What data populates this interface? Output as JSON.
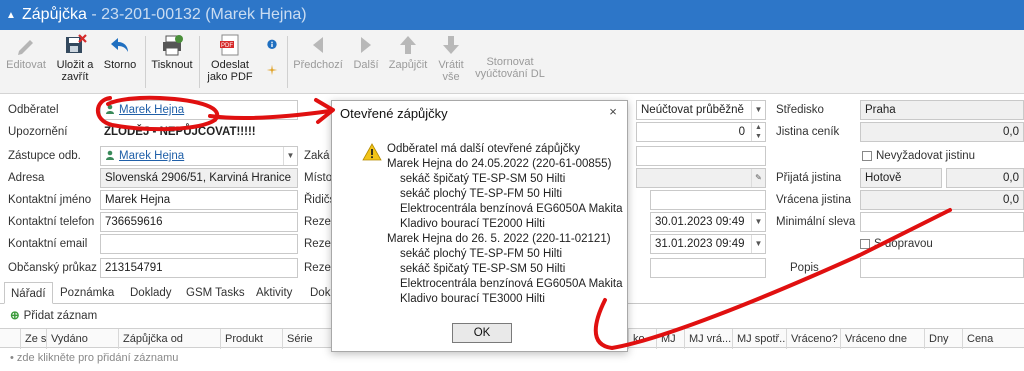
{
  "window": {
    "title": "Zápůjčka",
    "title_sep": " - ",
    "doc_ref": "23-201-00132 (Marek Hejna)"
  },
  "toolbar": {
    "edit": "Editovat",
    "save_close_1": "Uložit a",
    "save_close_2": "zavřít",
    "cancel": "Storno",
    "print": "Tisknout",
    "pdf_1": "Odeslat",
    "pdf_2": "jako PDF",
    "prev": "Předchozí",
    "next": "Další",
    "post": "Zapůjčit",
    "return_1": "Vrátit",
    "return_2": "vše",
    "cancel_bill_1": "Stornovat",
    "cancel_bill_2": "vyúčtování DL"
  },
  "form": {
    "customer_label": "Odběratel",
    "customer_value": "Marek Hejna",
    "warning_label": "Upozornění",
    "warning_value": "ZLODĚJ - NEPŮJČOVAT!!!!!",
    "rep_label": "Zástupce odb.",
    "rep_value": "Marek Hejna",
    "order_label": "Zaká",
    "address_label": "Adresa",
    "address_value": "Slovenská 2906/51, Karviná Hranice",
    "place_label": "Místo",
    "contact_name_label": "Kontaktní jméno",
    "contact_name_value": "Marek Hejna",
    "driver_label": "Řidičs",
    "contact_phone_label": "Kontaktní telefon",
    "contact_phone_value": "736659616",
    "reserv1_label": "Rezer",
    "contact_email_label": "Kontaktní email",
    "reserv2_label": "Rezer",
    "id_card_label": "Občanský průkaz",
    "id_card_value": "213154791",
    "reserv3_label": "Rezer",
    "billing_value": "Neúčtovat průběžně",
    "qty_value": "0",
    "date1_value": "30.01.2023 09:49",
    "date2_value": "31.01.2023 09:49",
    "center_label": "Středisko",
    "center_value": "Praha",
    "deposit_price_label": "Jistina ceník",
    "deposit_price_value": "0,0",
    "no_deposit_label": "Nevyžadovat jistinu",
    "accepted_deposit_label": "Přijatá jistina",
    "accepted_deposit_value": "Hotově",
    "accepted_deposit_amount": "0,0",
    "returned_deposit_label": "Vrácena jistina",
    "returned_deposit_value": "0,0",
    "min_discount_label": "Minimální sleva",
    "transport_label": "S dopravou",
    "note_label": "Popis"
  },
  "tabs": [
    {
      "label": "Nářadí"
    },
    {
      "label": "Poznámka"
    },
    {
      "label": "Doklady"
    },
    {
      "label": "GSM Tasks"
    },
    {
      "label": "Aktivity"
    },
    {
      "label": "Dok"
    }
  ],
  "grid": {
    "add_record": "Přidat záznam",
    "new_row_hint": "zde klikněte pro přidání záznamu",
    "columns": [
      "Ze s...",
      "Vydáno",
      "Zápůjčka od",
      "Produkt",
      "Série",
      "ko",
      "MJ",
      "MJ vrá...",
      "MJ spotř...",
      "Vráceno?",
      "Vráceno dne",
      "Dny",
      "Cena"
    ]
  },
  "dialog": {
    "title": "Otevřené zápůjčky",
    "close": "×",
    "lines": [
      "Odběratel má další otevřené zápůjčky",
      "Marek Hejna do 24.05.2022 (220-61-00855)",
      "sekáč špičatý TE-SP-SM 50 Hilti",
      "sekáč plochý TE-SP-FM 50 Hilti",
      "Elektrocentrála benzínová EG6050A Makita",
      "Kladivo bourací TE2000 Hilti",
      "Marek Hejna do 26. 5. 2022 (220-11-02121)",
      "sekáč plochý TE-SP-FM 50 Hilti",
      "sekáč špičatý TE-SP-SM 50 Hilti",
      "Elektrocentrála benzínová EG6050A Makita",
      "Kladivo bourací TE3000 Hilti"
    ],
    "ok": "OK"
  },
  "colors": {
    "titlebar": "#2d76c8",
    "annotation": "#e01010",
    "link": "#1f5fa8"
  }
}
